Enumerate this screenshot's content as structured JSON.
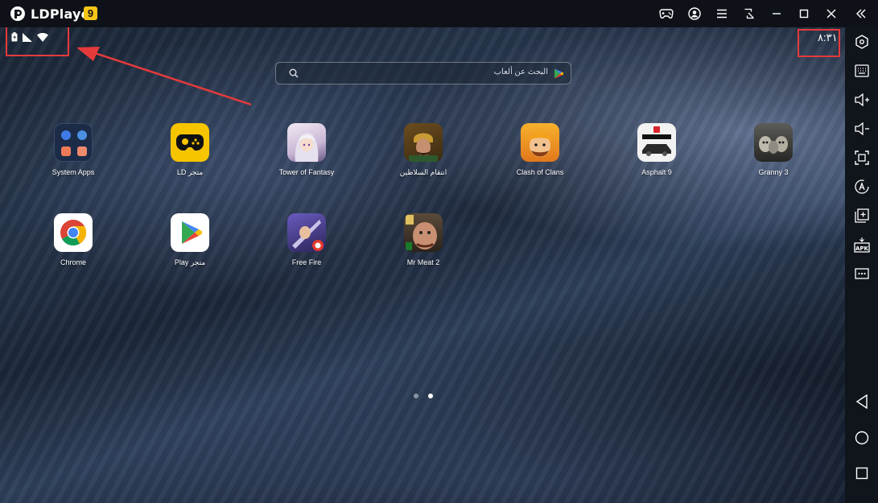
{
  "window": {
    "title": "LDPlayer",
    "version_badge": "9"
  },
  "titlebar_icons": [
    "gamepad-icon",
    "account-icon",
    "menu-icon",
    "sync-icon",
    "minimize-icon",
    "maximize-icon",
    "close-icon",
    "collapse-sidebar-icon"
  ],
  "status_bar": {
    "icons": [
      "battery-icon",
      "signal-icon",
      "wifi-icon"
    ],
    "clock": "٨:٣١"
  },
  "search": {
    "placeholder": "البحث عن ألعاب"
  },
  "apps": [
    {
      "label": "System Apps",
      "icon": "system-apps-folder-icon"
    },
    {
      "label": "LD متجر",
      "icon": "ld-store-icon"
    },
    {
      "label": "Tower of Fantasy",
      "icon": "tower-of-fantasy-icon"
    },
    {
      "label": "انتقام السلاطين",
      "icon": "sultans-revenge-icon"
    },
    {
      "label": "Clash of Clans",
      "icon": "clash-of-clans-icon"
    },
    {
      "label": "Asphalt 9",
      "icon": "asphalt-9-icon"
    },
    {
      "label": "Granny 3",
      "icon": "granny-3-icon"
    },
    {
      "label": "Chrome",
      "icon": "chrome-icon"
    },
    {
      "label": "Play متجر",
      "icon": "play-store-icon"
    },
    {
      "label": "Free Fire",
      "icon": "free-fire-icon"
    },
    {
      "label": "Mr Meat 2",
      "icon": "mr-meat-2-icon"
    }
  ],
  "page_indicator": {
    "pages": 2,
    "active": 2
  },
  "sidebar_tools": [
    "settings-icon",
    "keyboard-icon",
    "volume-up-icon",
    "volume-down-icon",
    "screenshot-icon",
    "auto-rotate-icon",
    "multi-instance-icon",
    "apk-install-icon",
    "more-icon",
    "back-icon",
    "home-icon",
    "recents-icon"
  ],
  "colors": {
    "highlight": "#e63a3a",
    "badge": "#f5c518"
  }
}
